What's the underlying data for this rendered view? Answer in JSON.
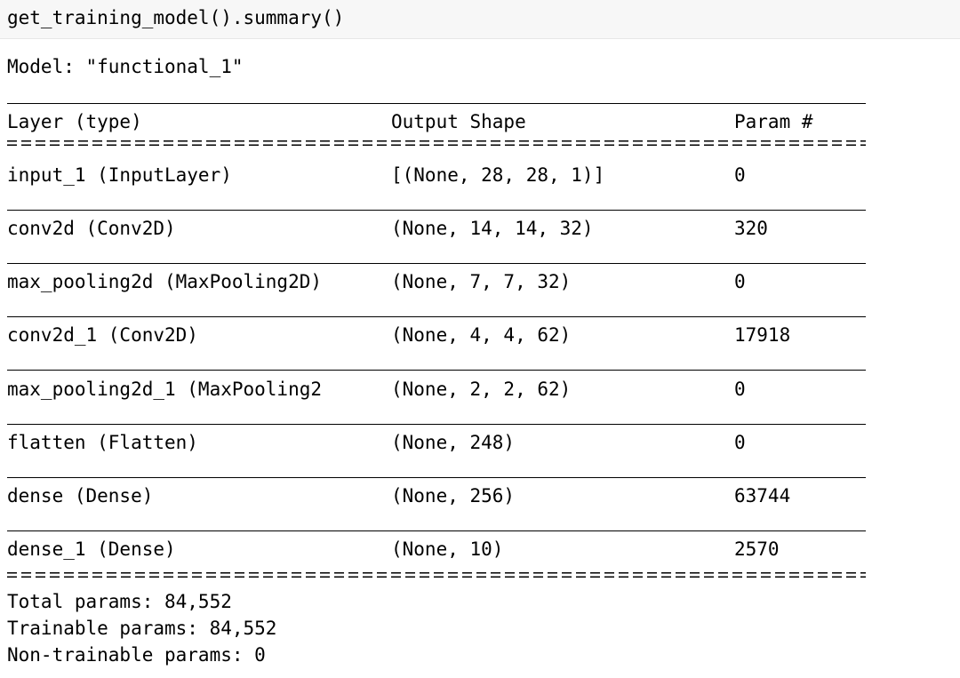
{
  "input_code": "get_training_model().summary()",
  "model_label": "Model: \"functional_1\"",
  "headers": {
    "layer": "Layer (type)",
    "output_shape": "Output Shape",
    "params": "Param #"
  },
  "rows": [
    {
      "layer": "input_1 (InputLayer)",
      "output_shape": "[(None, 28, 28, 1)]",
      "params": "0"
    },
    {
      "layer": "conv2d (Conv2D)",
      "output_shape": "(None, 14, 14, 32)",
      "params": "320"
    },
    {
      "layer": "max_pooling2d (MaxPooling2D)",
      "output_shape": "(None, 7, 7, 32)",
      "params": "0"
    },
    {
      "layer": "conv2d_1 (Conv2D)",
      "output_shape": "(None, 4, 4, 62)",
      "params": "17918"
    },
    {
      "layer": "max_pooling2d_1 (MaxPooling2",
      "output_shape": "(None, 2, 2, 62)",
      "params": "0"
    },
    {
      "layer": "flatten (Flatten)",
      "output_shape": "(None, 248)",
      "params": "0"
    },
    {
      "layer": "dense (Dense)",
      "output_shape": "(None, 256)",
      "params": "63744"
    },
    {
      "layer": "dense_1 (Dense)",
      "output_shape": "(None, 10)",
      "params": "2570"
    }
  ],
  "totals": {
    "total": "Total params: 84,552",
    "trainable": "Trainable params: 84,552",
    "non_trainable": "Non-trainable params: 0"
  }
}
